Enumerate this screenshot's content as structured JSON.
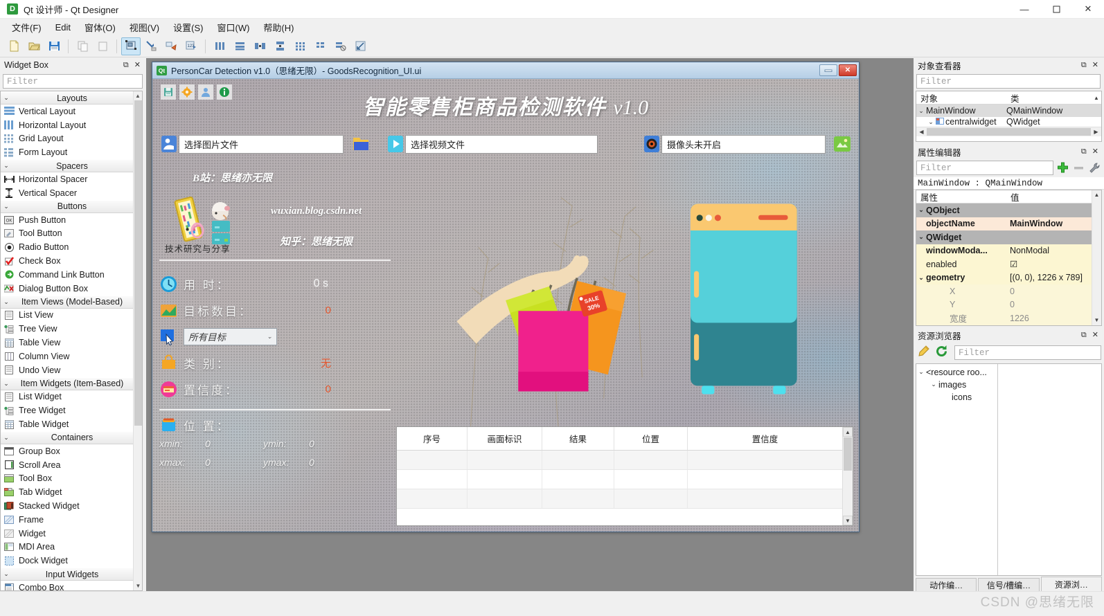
{
  "window": {
    "title": "Qt 设计师 - Qt Designer",
    "app_icon": "qt-designer-icon",
    "minimize": "—",
    "maximize": "▢",
    "close": "✕"
  },
  "menubar": {
    "items": [
      {
        "label": "文件(F)",
        "name": "menu-file"
      },
      {
        "label": "Edit",
        "name": "menu-edit"
      },
      {
        "label": "窗体(O)",
        "name": "menu-form"
      },
      {
        "label": "视图(V)",
        "name": "menu-view"
      },
      {
        "label": "设置(S)",
        "name": "menu-settings"
      },
      {
        "label": "窗口(W)",
        "name": "menu-window"
      },
      {
        "label": "帮助(H)",
        "name": "menu-help"
      }
    ]
  },
  "toolbar": {
    "groups": [
      [
        "new-form-icon",
        "open-form-icon",
        "save-form-icon"
      ],
      [
        "copy-icon",
        "paste-icon"
      ],
      [
        "edit-widgets-icon",
        "edit-signals-slots-icon",
        "edit-buddies-icon",
        "edit-tab-order-icon"
      ],
      [
        "layout-horizontally-icon",
        "layout-vertically-icon",
        "layout-splitter-horizontal-icon",
        "layout-splitter-vertical-icon",
        "layout-grid-icon",
        "layout-form-icon",
        "break-layout-icon",
        "adjust-size-icon"
      ]
    ]
  },
  "widget_box": {
    "title": "Widget Box",
    "filter_placeholder": "Filter",
    "undock": "⧉",
    "close": "✕",
    "categories": [
      {
        "name": "Layouts",
        "items": [
          {
            "label": "Vertical Layout",
            "icon": "vertical-layout-icon"
          },
          {
            "label": "Horizontal Layout",
            "icon": "horizontal-layout-icon"
          },
          {
            "label": "Grid Layout",
            "icon": "grid-layout-icon"
          },
          {
            "label": "Form Layout",
            "icon": "form-layout-icon"
          }
        ]
      },
      {
        "name": "Spacers",
        "items": [
          {
            "label": "Horizontal Spacer",
            "icon": "horizontal-spacer-icon"
          },
          {
            "label": "Vertical Spacer",
            "icon": "vertical-spacer-icon"
          }
        ]
      },
      {
        "name": "Buttons",
        "items": [
          {
            "label": "Push Button",
            "icon": "push-button-icon"
          },
          {
            "label": "Tool Button",
            "icon": "tool-button-icon"
          },
          {
            "label": "Radio Button",
            "icon": "radio-button-icon"
          },
          {
            "label": "Check Box",
            "icon": "check-box-icon"
          },
          {
            "label": "Command Link Button",
            "icon": "command-link-button-icon"
          },
          {
            "label": "Dialog Button Box",
            "icon": "dialog-button-box-icon"
          }
        ]
      },
      {
        "name": "Item Views (Model-Based)",
        "items": [
          {
            "label": "List View",
            "icon": "list-view-icon"
          },
          {
            "label": "Tree View",
            "icon": "tree-view-icon"
          },
          {
            "label": "Table View",
            "icon": "table-view-icon"
          },
          {
            "label": "Column View",
            "icon": "column-view-icon"
          },
          {
            "label": "Undo View",
            "icon": "undo-view-icon"
          }
        ]
      },
      {
        "name": "Item Widgets (Item-Based)",
        "items": [
          {
            "label": "List Widget",
            "icon": "list-widget-icon"
          },
          {
            "label": "Tree Widget",
            "icon": "tree-widget-icon"
          },
          {
            "label": "Table Widget",
            "icon": "table-widget-icon"
          }
        ]
      },
      {
        "name": "Containers",
        "items": [
          {
            "label": "Group Box",
            "icon": "group-box-icon"
          },
          {
            "label": "Scroll Area",
            "icon": "scroll-area-icon"
          },
          {
            "label": "Tool Box",
            "icon": "tool-box-icon"
          },
          {
            "label": "Tab Widget",
            "icon": "tab-widget-icon"
          },
          {
            "label": "Stacked Widget",
            "icon": "stacked-widget-icon"
          },
          {
            "label": "Frame",
            "icon": "frame-icon"
          },
          {
            "label": "Widget",
            "icon": "widget-icon"
          },
          {
            "label": "MDI Area",
            "icon": "mdi-area-icon"
          },
          {
            "label": "Dock Widget",
            "icon": "dock-widget-icon"
          }
        ]
      },
      {
        "name": "Input Widgets",
        "items": [
          {
            "label": "Combo Box",
            "icon": "combo-box-icon"
          }
        ]
      }
    ]
  },
  "form_window": {
    "title": "PersonCar Detection v1.0（思绪无限）- GoodsRecognition_UI.ui",
    "minimize": "—",
    "close": "✕",
    "app": {
      "icons": [
        "save-icon",
        "settings-icon",
        "user-icon",
        "info-icon"
      ],
      "heading": "智能零售柜商品检测软件",
      "version": "v1.0",
      "file_row": [
        {
          "name": "image-file",
          "icon": "image-select-icon",
          "value": "选择图片文件",
          "action_icon": "folder-open-icon"
        },
        {
          "name": "video-file",
          "icon": "video-play-icon",
          "value": "选择视频文件"
        },
        {
          "name": "camera",
          "icon": "camera-lens-icon",
          "value": "摄像头未开启",
          "action_icon": "camera-on-icon"
        }
      ],
      "info": {
        "bilibili": "B站：思绪亦无限",
        "logo_caption": "技术研究与分享",
        "blog": "wuxian.blog.csdn.net",
        "zhihu": "知乎：思绪无限"
      },
      "stats": [
        {
          "icon": "clock-icon",
          "label": "用 时：",
          "value": "0 s",
          "color": "#f2f2f2"
        },
        {
          "icon": "chart-icon",
          "label": "目标数目：",
          "value": "0",
          "color": "#e0522a"
        }
      ],
      "target_select": {
        "value": "所有目标",
        "arrow": "⌄"
      },
      "stats2": [
        {
          "icon": "bag-icon",
          "label": "类 别：",
          "value": "无",
          "color": "#e0522a"
        },
        {
          "icon": "confidence-icon",
          "label": "置信度：",
          "value": "0",
          "color": "#e0522a"
        }
      ],
      "position": {
        "icon": "position-icon",
        "label": "位 置：",
        "fields": [
          {
            "key": "xmin:",
            "value": "0"
          },
          {
            "key": "ymin:",
            "value": "0"
          },
          {
            "key": "xmax:",
            "value": "0"
          },
          {
            "key": "ymax:",
            "value": "0"
          }
        ]
      },
      "table": {
        "headers": [
          "序号",
          "画面标识",
          "结果",
          "位置",
          "置信度"
        ],
        "rows": [
          [
            "",
            "",
            "",
            "",
            ""
          ],
          [
            "",
            "",
            "",
            "",
            ""
          ],
          [
            "",
            "",
            "",
            "",
            ""
          ]
        ]
      }
    }
  },
  "object_inspector": {
    "title": "对象查看器",
    "undock": "⧉",
    "close": "✕",
    "filter_placeholder": "Filter",
    "columns": [
      "对象",
      "类"
    ],
    "rows": [
      {
        "object": "MainWindow",
        "class": "QMainWindow",
        "indent": 0,
        "expanded": true,
        "selected": true
      },
      {
        "object": "centralwidget",
        "class": "QWidget",
        "indent": 1,
        "expanded": true,
        "selected": false
      }
    ]
  },
  "property_editor": {
    "title": "属性编辑器",
    "undock": "⧉",
    "close": "✕",
    "filter_placeholder": "Filter",
    "add_icon": "add-icon",
    "remove_icon": "remove-icon",
    "configure_icon": "wrench-icon",
    "object_line": "MainWindow : QMainWindow",
    "columns": [
      "属性",
      "值"
    ],
    "rows": [
      {
        "name": "QObject",
        "value": "",
        "type": "group"
      },
      {
        "name": "objectName",
        "value": "MainWindow",
        "type": "highlight"
      },
      {
        "name": "QWidget",
        "value": "",
        "type": "group"
      },
      {
        "name": "windowModa...",
        "value": "NonModal",
        "type": "yellow-bold"
      },
      {
        "name": "enabled",
        "value": "☑",
        "type": "yellow"
      },
      {
        "name": "geometry",
        "value": "[(0, 0), 1226 x 789]",
        "type": "yellow-bold-expand"
      },
      {
        "name": "X",
        "value": "0",
        "type": "sub"
      },
      {
        "name": "Y",
        "value": "0",
        "type": "sub"
      },
      {
        "name": "宽度",
        "value": "1226",
        "type": "sub"
      }
    ]
  },
  "resource_browser": {
    "title": "资源浏览器",
    "undock": "⧉",
    "close": "✕",
    "edit_icon": "pencil-icon",
    "reload_icon": "reload-icon",
    "filter_placeholder": "Filter",
    "tree": [
      {
        "label": "<resource roo...",
        "indent": 0,
        "expanded": true
      },
      {
        "label": "images",
        "indent": 1,
        "expanded": true
      },
      {
        "label": "icons",
        "indent": 2,
        "expanded": false
      }
    ]
  },
  "bottom_tabs": [
    {
      "label": "动作编…",
      "name": "tab-action-editor",
      "active": false
    },
    {
      "label": "信号/槽编…",
      "name": "tab-signal-slot-editor",
      "active": false
    },
    {
      "label": "资源浏…",
      "name": "tab-resource-browser",
      "active": true
    }
  ],
  "watermark": "CSDN @思绪无限",
  "colors": {
    "accent_orange": "#e0522a",
    "title_bg": "#ffffff",
    "dock_bg": "#f0f0f0",
    "mdi_bg": "#868686",
    "selection": "#cce6f7"
  }
}
